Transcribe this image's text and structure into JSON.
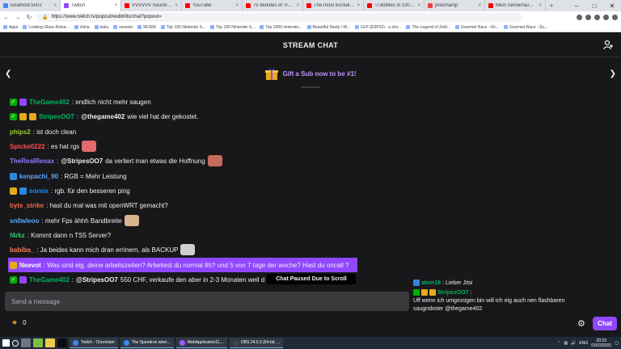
{
  "browser": {
    "tabs": [
      {
        "label": "localhost:5002",
        "color": "#4285f4",
        "active": false
      },
      {
        "label": "Twitch",
        "color": "#9146ff",
        "active": true
      },
      {
        "label": "VVVVVV Soundtrack %",
        "color": "#ff0000",
        "active": false
      },
      {
        "label": "YouTube",
        "color": "#ff0000",
        "active": false
      },
      {
        "label": "75 Minutes of Tropi",
        "color": "#ff0000",
        "active": false
      },
      {
        "label": "The most incredible 8-b",
        "color": "#ff0000",
        "active": false
      },
      {
        "label": "~/.dotfiles in 100 Seco",
        "color": "#ff0000",
        "active": false
      },
      {
        "label": "pretchamp",
        "color": "#e8453c",
        "active": false
      },
      {
        "label": "Mein Serverraum | Der",
        "color": "#ff0000",
        "active": false
      }
    ],
    "url": "https://www.twitch.tv/popout/wubb0ts/chat?popout=",
    "bookmarks": [
      "Apps",
      "Looking Glass Relea...",
      "china",
      "kaku",
      "session",
      "MUSIK",
      "Top 100 Nintendo S...",
      "Top 100 Nintendo S...",
      "Top 1000 nintendo...",
      "Beautiful Study / W...",
      "ULP (ESP32) - a sim...",
      "The Legend of Zeld...",
      "Gourmet Race - Kir...",
      "Gourmet Race - Su..."
    ]
  },
  "chat": {
    "title": "STREAM CHAT",
    "gift_text": "Gift a Sub now to be #1!",
    "paused_label": "Chat Paused Due to Scroll",
    "input_placeholder": "Send a message",
    "points": "0",
    "chat_button": "Chat",
    "messages": [
      {
        "badges": [
          "check",
          "prime"
        ],
        "user": "TheGame402",
        "color": "#00b35f",
        "mention": "",
        "text": ": endlich nicht mehr saugen",
        "emote": ""
      },
      {
        "badges": [
          "check",
          "tier",
          "tier"
        ],
        "user": "StripesOO7",
        "color": "#00b35f",
        "mention": "@thegame402",
        "text": " wie viel hat der gekostet.",
        "emote": ""
      },
      {
        "badges": [],
        "user": "phips2",
        "color": "#9acd32",
        "mention": "",
        "text": ": ist doch clean",
        "emote": ""
      },
      {
        "badges": [],
        "user": "Spicke0222",
        "color": "#ff4f4f",
        "mention": "",
        "text": ": es hat rgs",
        "emote": "#e06c6c"
      },
      {
        "badges": [],
        "user": "TheRealRenax",
        "color": "#8a7cff",
        "mention": "@StripesOO7",
        "text": " da verliert man etwas die Hoffnung",
        "emote": "#c66b5a"
      },
      {
        "badges": [
          "sub"
        ],
        "user": "kenpachi_90",
        "color": "#5fa8ff",
        "mention": "",
        "text": ": RGB = Mehr Leistung",
        "emote": ""
      },
      {
        "badges": [
          "tier",
          "sub"
        ],
        "user": "sornix",
        "color": "#1e90ff",
        "mention": "",
        "text": ": rgb. für den besseren ping",
        "emote": ""
      },
      {
        "badges": [],
        "user": "byte_strike",
        "color": "#ff6347",
        "mention": "",
        "text": ": hast du mal was mit openWRT gemacht?",
        "emote": ""
      },
      {
        "badges": [],
        "user": "sn0wleoo",
        "color": "#5fa8ff",
        "mention": "",
        "text": ": mehr Fps ähhh Bandbreite",
        "emote": "#d9b38c"
      },
      {
        "badges": [],
        "user": "f4rkz",
        "color": "#2ecc71",
        "mention": "",
        "text": ": Kommt dann n TS5 Server?",
        "emote": ""
      },
      {
        "badges": [],
        "user": "babiba_",
        "color": "#ff7f50",
        "mention": "",
        "text": ": Ja beides kann mich dran errinern, als BACKUP",
        "emote": "#cfcfcf"
      },
      {
        "badges": [
          "tier"
        ],
        "user": "Neevot",
        "color": "#ffffff",
        "mention": "",
        "text": ": Was sind eig. deine arbeitszeiten? Arbeitest du normal 8h? und 5 von 7 tage der woche? Hast du oncall ?",
        "emote": "",
        "highlight": true
      },
      {
        "badges": [
          "check",
          "prime"
        ],
        "user": "TheGame402",
        "color": "#00b35f",
        "mention": "@StripesOO7",
        "text": " 550 CHF, verkaufe den aber in 2-3 Monaten weil d",
        "emote": ""
      }
    ]
  },
  "side_chat": {
    "lines": [
      {
        "user": "aknn16",
        "color": "#00b35f",
        "text": ": Lieber Jitsi"
      },
      {
        "user": "StripesOO7",
        "color": "#00b35f",
        "text": ":"
      },
      {
        "user": "",
        "color": "#efeff1",
        "text": "Uff wenn ich umgezogen bin will ich eig auch nen flashbaren"
      },
      {
        "user": "",
        "color": "#efeff1",
        "text": "saugroboter @thegame402"
      }
    ]
  },
  "taskbar": {
    "apps": [
      {
        "label": "Twitch - Chromium",
        "color": "#4285f4"
      },
      {
        "label": "The Speedrun wher...",
        "color": "#4285f4"
      },
      {
        "label": "WebApplication11....",
        "color": "#a259ff"
      },
      {
        "label": "OBS 24.0.3 (64-bit, ...",
        "color": "#444444"
      }
    ],
    "lang": "ENG",
    "time": "20:23",
    "date": "01/02/2021"
  }
}
